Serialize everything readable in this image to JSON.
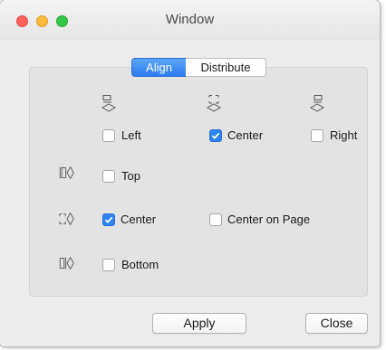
{
  "window": {
    "title": "Window",
    "traffic_lights": [
      "close",
      "minimize",
      "zoom"
    ]
  },
  "tabs": [
    {
      "label": "Align",
      "selected": true
    },
    {
      "label": "Distribute",
      "selected": false
    }
  ],
  "horizontal": {
    "left": {
      "label": "Left",
      "checked": false,
      "icon": "align-left-icon"
    },
    "center": {
      "label": "Center",
      "checked": true,
      "icon": "align-center-horizontal-icon"
    },
    "right": {
      "label": "Right",
      "checked": false,
      "icon": "align-right-icon"
    }
  },
  "vertical": {
    "top": {
      "label": "Top",
      "checked": false,
      "icon": "align-top-icon"
    },
    "center": {
      "label": "Center",
      "checked": true,
      "icon": "align-center-vertical-icon"
    },
    "bottom": {
      "label": "Bottom",
      "checked": false,
      "icon": "align-bottom-icon"
    }
  },
  "center_on_page": {
    "label": "Center on Page",
    "checked": false
  },
  "buttons": {
    "apply": "Apply",
    "close": "Close"
  },
  "colors": {
    "accent": "#2d83f2",
    "window_bg": "#ececec",
    "panel_bg": "#e3e3e3"
  }
}
